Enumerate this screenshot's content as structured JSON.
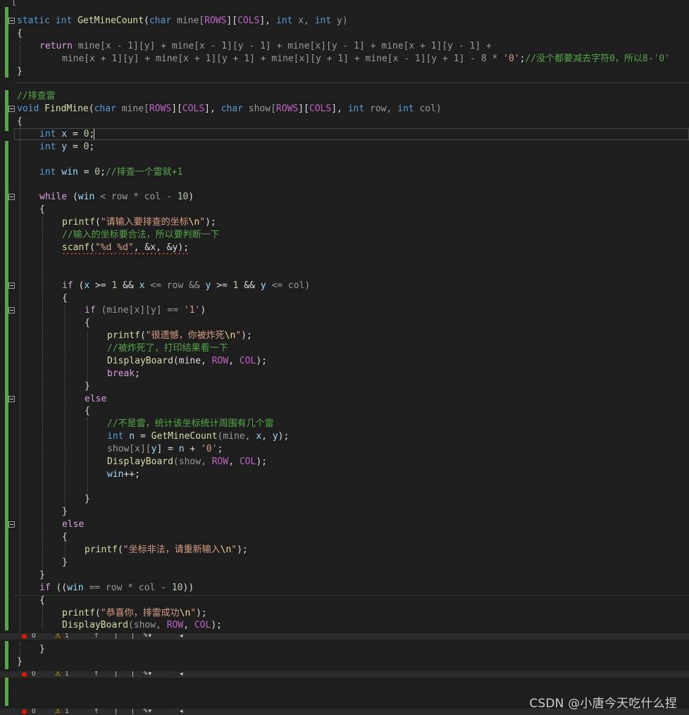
{
  "code": {
    "l1_a": "static",
    "l1_b": "int",
    "l1_c": "GetMineCount",
    "l1_d": "(",
    "l1_e": "char",
    "l1_f": " mine[",
    "l1_g": "ROWS",
    "l1_h": "][",
    "l1_i": "COLS",
    "l1_j": "], ",
    "l1_k": "int",
    "l1_l": " x, ",
    "l1_m": "int",
    "l1_n": " y)",
    "l2": "{",
    "l3_a": "return",
    "l3_b": " mine[x - 1][y] + mine[x - 1][y - 1] + mine[x][y - 1] + mine[x + 1][y - 1] +",
    "l4_a": "mine[x + 1][y] + mine[x + 1][y + 1] + mine[x][y + 1] + mine[x - 1][y + 1] - 8 * ",
    "l4_b": "'0'",
    "l4_c": ";",
    "l4_d": "//没个都要减去字符0，所以8-'0'",
    "l5": "}",
    "l6": "//排查雷",
    "l7_a": "void",
    "l7_b": " FindMine",
    "l7_c": "(",
    "l7_d": "char",
    "l7_e": " mine[",
    "l7_f": "ROWS",
    "l7_g": "][",
    "l7_h": "COLS",
    "l7_i": "], ",
    "l7_j": "char",
    "l7_k": " show[",
    "l7_l": "ROWS",
    "l7_m": "][",
    "l7_n": "COLS",
    "l7_o": "], ",
    "l7_p": "int",
    "l7_q": " row, ",
    "l7_r": "int",
    "l7_s": " col)",
    "l8": "{",
    "l9_a": "int",
    "l9_b": " x",
    "l9_c": " = ",
    "l9_d": "0",
    "l9_e": ";",
    "l10_a": "int",
    "l10_b": " y",
    "l10_c": " = ",
    "l10_d": "0",
    "l10_e": ";",
    "l11_a": "int",
    "l11_b": " win",
    "l11_c": " = ",
    "l11_d": "0",
    "l11_e": ";",
    "l11_f": "//排查一个雷就+1",
    "l12_a": "while",
    "l12_b": " (",
    "l12_c": "win",
    "l12_d": " < row * col - ",
    "l12_e": "10",
    "l12_f": ")",
    "l13": "{",
    "l14_a": "printf",
    "l14_b": "(",
    "l14_c": "\"请输入要排查的坐标",
    "l14_d": "\\n",
    "l14_e": "\"",
    "l14_f": ");",
    "l15": "//输入的坐标要合法，所以要判断一下",
    "l16_a": "scanf",
    "l16_b": "(",
    "l16_c": "\"%d %d\"",
    "l16_d": ", &x, &y);",
    "l17_a": "if",
    "l17_b": " (",
    "l17_c": "x",
    "l17_d": " >= ",
    "l17_e": "1",
    "l17_f": " && ",
    "l17_g": "x",
    "l17_h": " <= row && ",
    "l17_i": "y",
    "l17_j": " >= ",
    "l17_k": "1",
    "l17_l": " && ",
    "l17_m": "y",
    "l17_n": " <= col)",
    "l18": "{",
    "l19_a": "if",
    "l19_b": " (mine[x][y] == ",
    "l19_c": "'1'",
    "l19_d": ")",
    "l20": "{",
    "l21_a": "printf",
    "l21_b": "(",
    "l21_c": "\"很遗憾，你被炸死",
    "l21_d": "\\n",
    "l21_e": "\"",
    "l21_f": ");",
    "l22": "//被炸死了，打印结果看一下",
    "l23_a": "DisplayBoard",
    "l23_b": "(mine, ",
    "l23_c": "ROW",
    "l23_d": ", ",
    "l23_e": "COL",
    "l23_f": ");",
    "l24_a": "break",
    "l24_b": ";",
    "l25": "}",
    "l26": "else",
    "l27": "{",
    "l28": "//不是雷，统计该坐标统计周围有几个雷",
    "l29_a": "int",
    "l29_b": " n",
    "l29_c": " = ",
    "l29_d": "GetMineCount",
    "l29_e": "(mine, ",
    "l29_f": "x",
    "l29_g": ", ",
    "l29_h": "y",
    "l29_i": ");",
    "l30_a": "show[x][",
    "l30_b": "y",
    "l30_c": "] = ",
    "l30_d": "n",
    "l30_e": " + ",
    "l30_f": "'0'",
    "l30_g": ";",
    "l31_a": "DisplayBoard",
    "l31_b": "(show, ",
    "l31_c": "ROW",
    "l31_d": ", ",
    "l31_e": "COL",
    "l31_f": ");",
    "l32_a": "win",
    "l32_b": "++;",
    "l33": "}",
    "l34": "}",
    "l35": "else",
    "l36": "{",
    "l37_a": "printf",
    "l37_b": "(",
    "l37_c": "\"坐标非法，请重新输入",
    "l37_d": "\\n",
    "l37_e": "\"",
    "l37_f": ");",
    "l38": "}",
    "l39": "}",
    "l40_a": "if",
    "l40_b": " ((",
    "l40_c": "win",
    "l40_d": " == row * col - ",
    "l40_e": "10",
    "l40_f": "))",
    "l41": "{",
    "l42_a": "printf",
    "l42_b": "(",
    "l42_c": "\"恭喜你，排雷成功",
    "l42_d": "\\n",
    "l42_e": "\"",
    "l42_f": ");",
    "l43_a": "DisplayBoard",
    "l43_b": "(show, ",
    "l43_c": "ROW",
    "l43_d": ", ",
    "l43_e": "COL",
    "l43_f": ");",
    "l44": "}",
    "l45": "}"
  },
  "status_bar": {
    "errors": "0",
    "warnings": "1"
  },
  "watermark": "CSDN @小唐今天吃什么捏",
  "icons": {
    "error": "error-icon",
    "warning": "warning-icon",
    "fold": "fold-toggle-icon"
  }
}
